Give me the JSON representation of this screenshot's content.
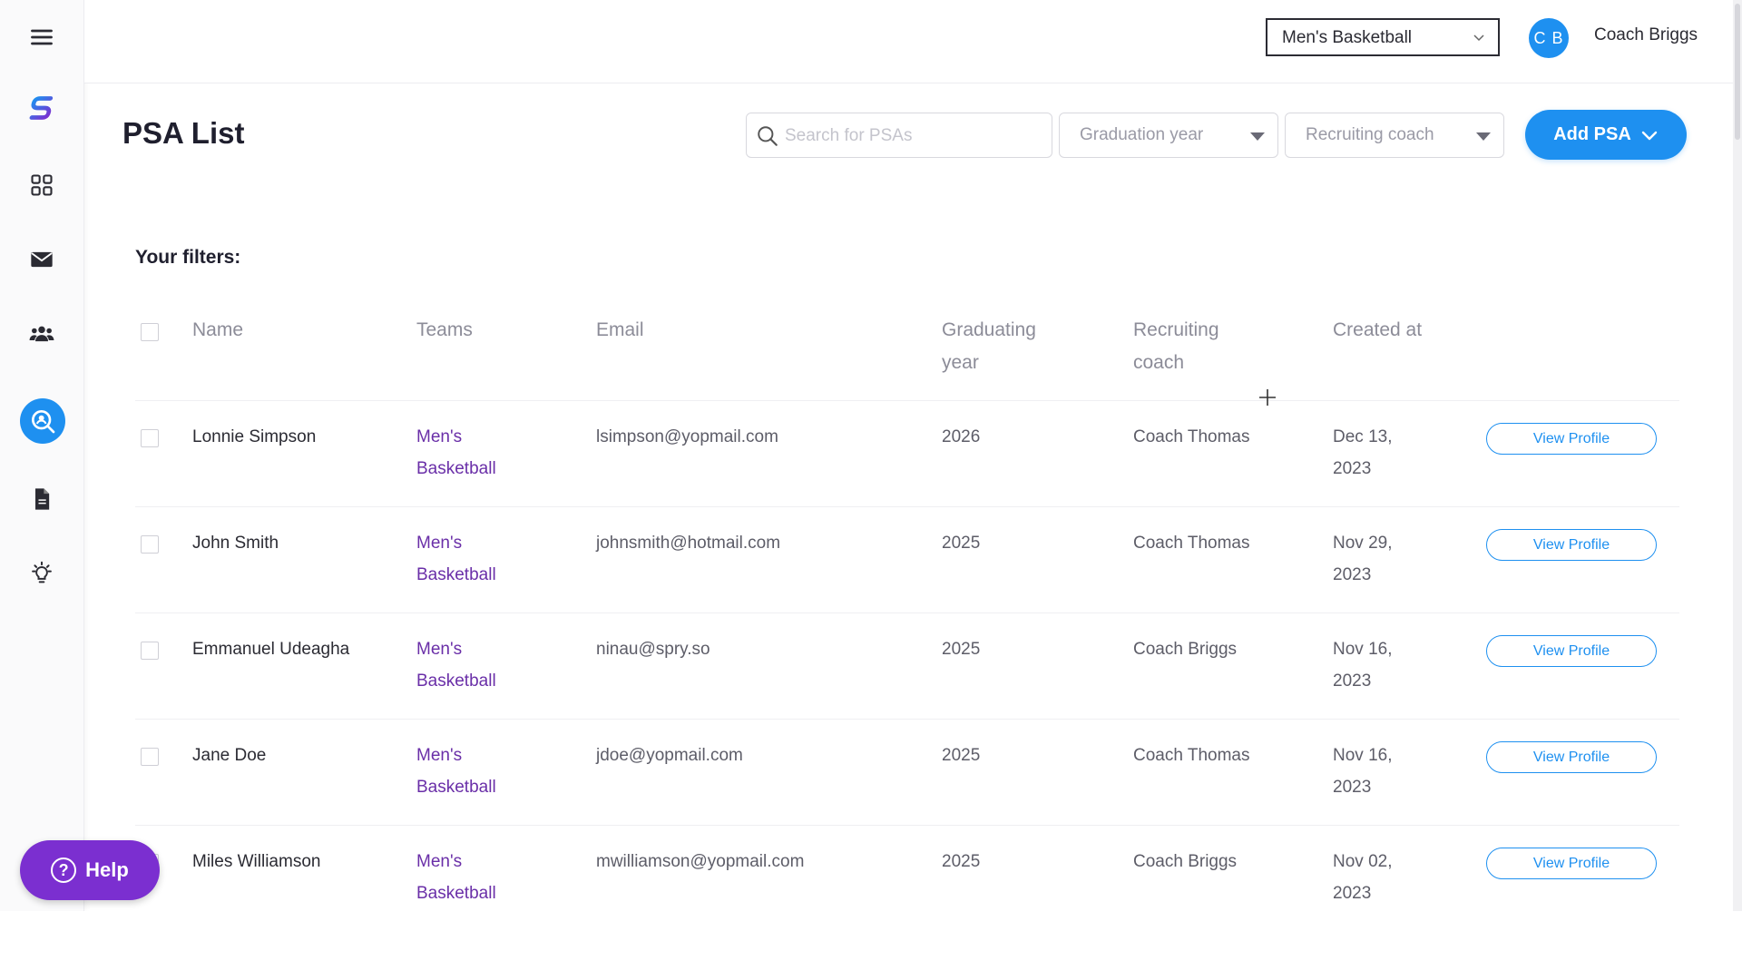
{
  "header": {
    "team_select": "Men's Basketball",
    "avatar_initials": "C B",
    "user_name": "Coach Briggs"
  },
  "page": {
    "title": "PSA List",
    "search_placeholder": "Search for PSAs",
    "graduation_filter": "Graduation year",
    "coach_filter": "Recruiting coach",
    "add_button": "Add PSA",
    "filters_label": "Your filters:"
  },
  "table": {
    "headers": {
      "name": "Name",
      "teams": "Teams",
      "email": "Email",
      "grad_year": "Graduating year",
      "coach": "Recruiting coach",
      "created": "Created at"
    },
    "view_label": "View Profile",
    "rows": [
      {
        "name": "Lonnie Simpson",
        "team": "Men's Basketball",
        "email": "lsimpson@yopmail.com",
        "grad": "2026",
        "coach": "Coach Thomas",
        "created": "Dec 13, 2023"
      },
      {
        "name": "John Smith",
        "team": "Men's Basketball",
        "email": "johnsmith@hotmail.com",
        "grad": "2025",
        "coach": "Coach Thomas",
        "created": "Nov 29, 2023"
      },
      {
        "name": "Emmanuel  Udeagha",
        "team": "Men's Basketball",
        "email": "ninau@spry.so",
        "grad": "2025",
        "coach": "Coach Briggs",
        "created": "Nov 16, 2023"
      },
      {
        "name": "Jane Doe",
        "team": "Men's Basketball",
        "email": "jdoe@yopmail.com",
        "grad": "2025",
        "coach": "Coach Thomas",
        "created": "Nov 16, 2023"
      },
      {
        "name": "Miles Williamson",
        "team": "Men's Basketball",
        "email": "mwilliamson@yopmail.com",
        "grad": "2025",
        "coach": "Coach Briggs",
        "created": "Nov 02, 2023"
      }
    ]
  },
  "help": {
    "label": "Help"
  },
  "colors": {
    "accent": "#1e90f0",
    "team_link": "#6a2fa8",
    "help": "#7b2fd0"
  }
}
